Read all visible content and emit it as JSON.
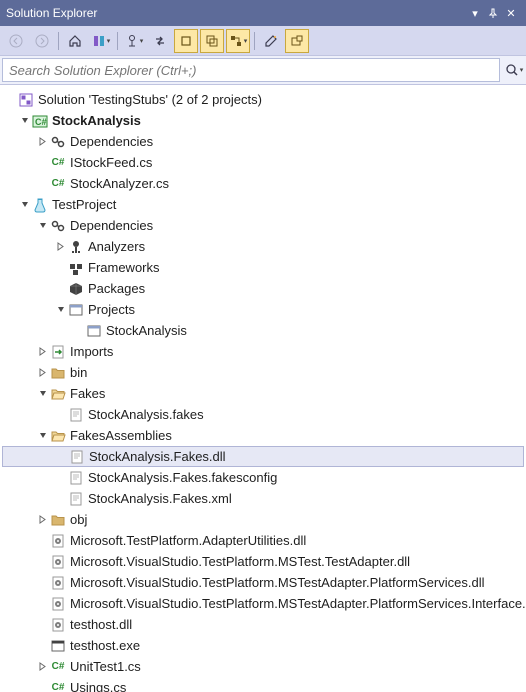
{
  "window": {
    "title": "Solution Explorer",
    "search_placeholder": "Search Solution Explorer (Ctrl+;)"
  },
  "solution": {
    "label": "Solution 'TestingStubs' (2 of 2 projects)"
  },
  "tree": {
    "p1": {
      "name": "StockAnalysis"
    },
    "p1_dep": "Dependencies",
    "p1_f1": "IStockFeed.cs",
    "p1_f2": "StockAnalyzer.cs",
    "p2": {
      "name": "TestProject"
    },
    "p2_dep": "Dependencies",
    "p2_dep_a": "Analyzers",
    "p2_dep_f": "Frameworks",
    "p2_dep_pk": "Packages",
    "p2_dep_pr": "Projects",
    "p2_dep_pr_sa": "StockAnalysis",
    "p2_imp": "Imports",
    "p2_bin": "bin",
    "p2_fakes": "Fakes",
    "p2_fakes_f1": "StockAnalysis.fakes",
    "p2_fa": "FakesAssemblies",
    "p2_fa_f1": "StockAnalysis.Fakes.dll",
    "p2_fa_f2": "StockAnalysis.Fakes.fakesconfig",
    "p2_fa_f3": "StockAnalysis.Fakes.xml",
    "p2_obj": "obj",
    "p2_d1": "Microsoft.TestPlatform.AdapterUtilities.dll",
    "p2_d2": "Microsoft.VisualStudio.TestPlatform.MSTest.TestAdapter.dll",
    "p2_d3": "Microsoft.VisualStudio.TestPlatform.MSTestAdapter.PlatformServices.dll",
    "p2_d4": "Microsoft.VisualStudio.TestPlatform.MSTestAdapter.PlatformServices.Interface.dll",
    "p2_d5": "testhost.dll",
    "p2_d6": "testhost.exe",
    "p2_u1": "UnitTest1.cs",
    "p2_u2": "Usings.cs"
  }
}
